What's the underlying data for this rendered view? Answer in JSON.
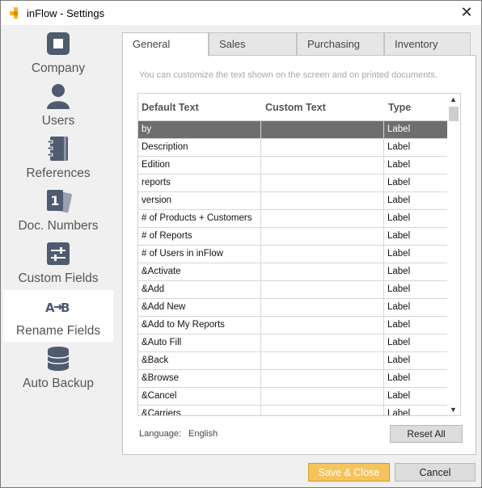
{
  "window": {
    "title": "inFlow - Settings",
    "close_glyph": "✕"
  },
  "sidebar": {
    "items": [
      {
        "label": "Company",
        "icon": "building-icon"
      },
      {
        "label": "Users",
        "icon": "user-icon"
      },
      {
        "label": "References",
        "icon": "notebook-icon"
      },
      {
        "label": "Doc. Numbers",
        "icon": "document-number-icon"
      },
      {
        "label": "Custom Fields",
        "icon": "sliders-icon"
      },
      {
        "label": "Rename Fields",
        "icon": "rename-ab-icon",
        "active": true
      },
      {
        "label": "Auto Backup",
        "icon": "database-icon"
      }
    ]
  },
  "tabs": [
    {
      "label": "General",
      "active": true
    },
    {
      "label": "Sales"
    },
    {
      "label": "Purchasing"
    },
    {
      "label": "Inventory"
    }
  ],
  "panel": {
    "hint": "You can customize the text shown on the screen and on printed documents.",
    "columns": [
      "Default Text",
      "Custom Text",
      "Type"
    ],
    "rows": [
      {
        "default": "by",
        "custom": "",
        "type": "Label"
      },
      {
        "default": "Description",
        "custom": "",
        "type": "Label"
      },
      {
        "default": "Edition",
        "custom": "",
        "type": "Label"
      },
      {
        "default": "reports",
        "custom": "",
        "type": "Label"
      },
      {
        "default": "version",
        "custom": "",
        "type": "Label"
      },
      {
        "default": "# of Products + Customers",
        "custom": "",
        "type": "Label"
      },
      {
        "default": "# of Reports",
        "custom": "",
        "type": "Label"
      },
      {
        "default": "# of Users in inFlow",
        "custom": "",
        "type": "Label"
      },
      {
        "default": "&Activate",
        "custom": "",
        "type": "Label"
      },
      {
        "default": "&Add",
        "custom": "",
        "type": "Label"
      },
      {
        "default": "&Add New",
        "custom": "",
        "type": "Label"
      },
      {
        "default": "&Add to My Reports",
        "custom": "",
        "type": "Label"
      },
      {
        "default": "&Auto Fill",
        "custom": "",
        "type": "Label"
      },
      {
        "default": "&Back",
        "custom": "",
        "type": "Label"
      },
      {
        "default": "&Browse",
        "custom": "",
        "type": "Label"
      },
      {
        "default": "&Cancel",
        "custom": "",
        "type": "Label"
      },
      {
        "default": "&Carriers",
        "custom": "",
        "type": "Label"
      }
    ],
    "selected_row": 0,
    "language_label": "Language:",
    "language_value": "English",
    "reset_label": "Reset All"
  },
  "footer": {
    "save_label": "Save & Close",
    "cancel_label": "Cancel"
  },
  "colors": {
    "accent": "#f6c35c",
    "selected_row": "#6e6e6e",
    "icon": "#4f5b6e"
  }
}
